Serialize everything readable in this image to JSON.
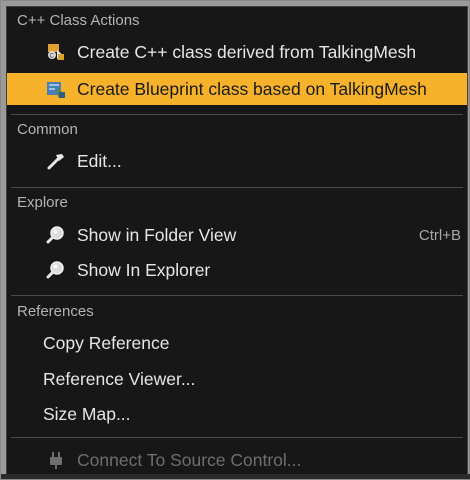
{
  "sections": {
    "cpp_header": "C++ Class Actions",
    "common_header": "Common",
    "explore_header": "Explore",
    "references_header": "References"
  },
  "items": {
    "create_cpp": "Create C++ class derived from TalkingMesh",
    "create_blueprint": "Create Blueprint class based on TalkingMesh",
    "edit": "Edit...",
    "show_folder": "Show in Folder View",
    "show_folder_shortcut": "Ctrl+B",
    "show_explorer": "Show In Explorer",
    "copy_reference": "Copy Reference",
    "reference_viewer": "Reference Viewer...",
    "size_map": "Size Map...",
    "connect_source": "Connect To Source Control..."
  },
  "colors": {
    "menu_background": "#171717",
    "highlight": "#f5b22a",
    "text": "#e6e6e6",
    "header_text": "#b4b4b4",
    "disabled_text": "#6e6e6e"
  },
  "icons": {
    "create_cpp": "cpp-class-icon",
    "create_blueprint": "blueprint-class-icon",
    "edit": "hammer-edit-icon",
    "show_folder": "magnifier-icon",
    "show_explorer": "magnifier-icon",
    "connect_source": "plug-icon"
  },
  "state": {
    "highlighted_item": "create_blueprint",
    "disabled_items": [
      "connect_source"
    ]
  }
}
